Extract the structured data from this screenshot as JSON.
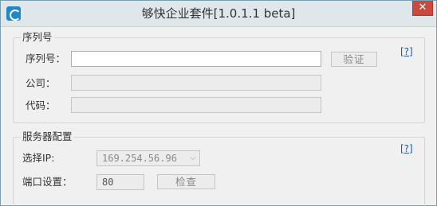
{
  "window": {
    "title": "够快企业套件[1.0.1.1 beta]",
    "close_glyph": "✕"
  },
  "serial_group": {
    "legend": "序列号",
    "serial_label": "序列号：",
    "serial_value": "",
    "verify_button": "验证",
    "company_label": "公司：",
    "company_value": "",
    "code_label": "代码：",
    "code_value": "",
    "help_link": "[?]"
  },
  "server_group": {
    "legend": "服务器配置",
    "ip_label": "选择IP:",
    "ip_selected": "169.254.56.96",
    "port_label": "端口设置：",
    "port_value": "80",
    "check_button": "检查",
    "help_link": "[?]"
  },
  "colors": {
    "close_bg": "#c94a3f",
    "link": "#1a5aa8",
    "app_icon": "#1e88c8"
  }
}
